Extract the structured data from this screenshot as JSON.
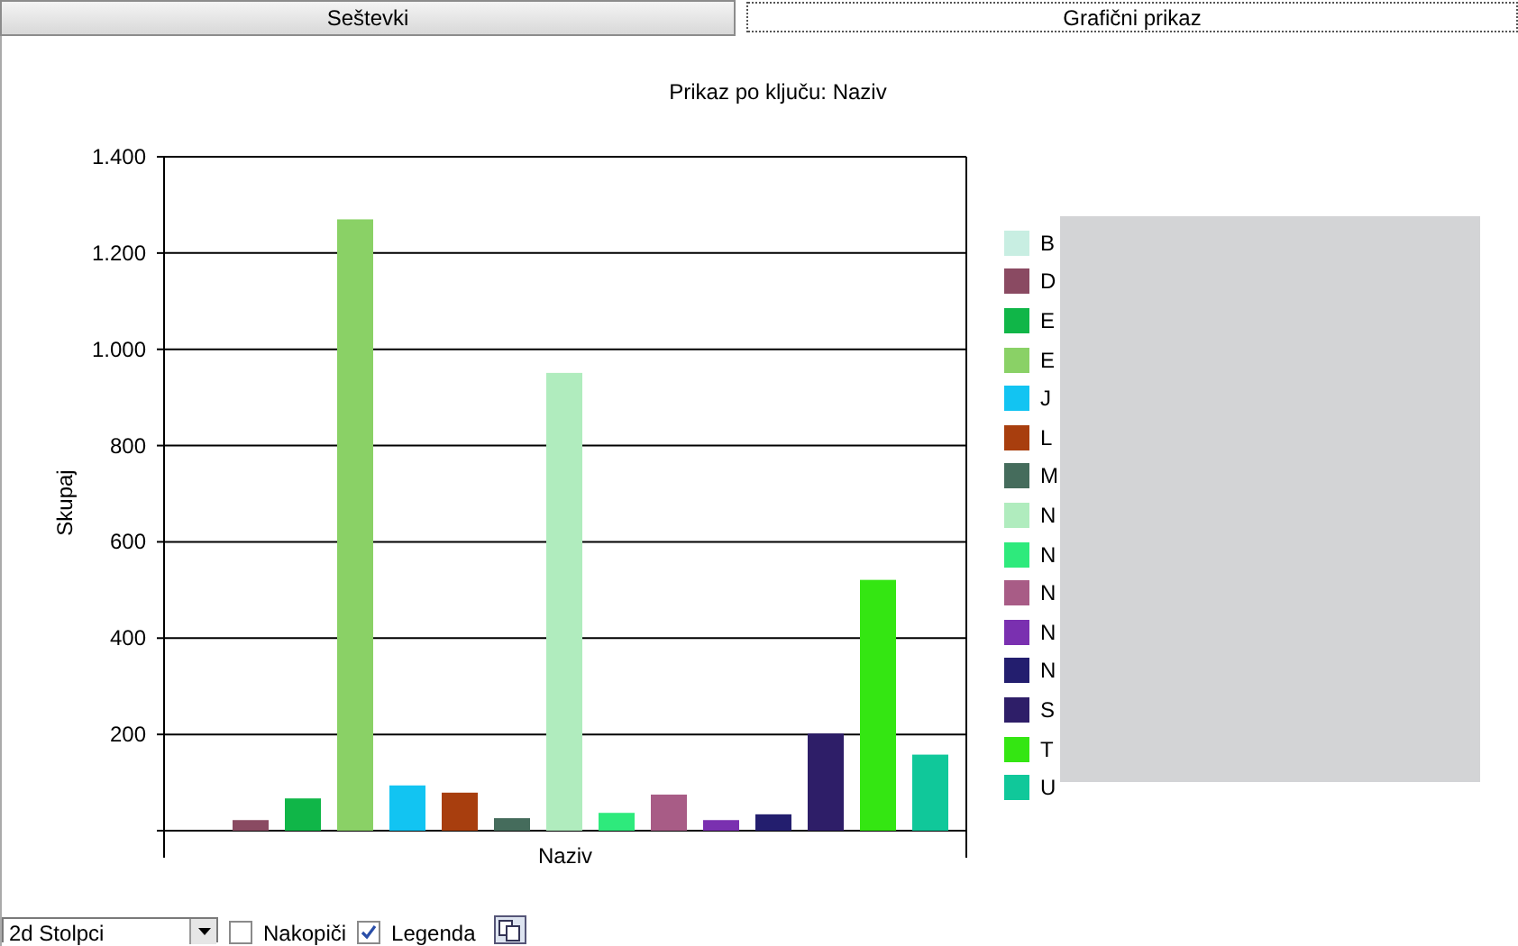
{
  "tabs": [
    {
      "label": "Seštevki",
      "selected": false
    },
    {
      "label": "Grafični prikaz",
      "selected": true
    }
  ],
  "chart": {
    "chart_data": {
      "type": "bar",
      "title": "Prikaz po ključu: Naziv",
      "ylabel": "Skupaj",
      "categories": [
        "Naziv"
      ],
      "ylim": [
        0,
        1400
      ],
      "grid": true,
      "yticks": [
        {
          "value": 200,
          "label": "200"
        },
        {
          "value": 400,
          "label": "400"
        },
        {
          "value": 600,
          "label": "600"
        },
        {
          "value": 800,
          "label": "800"
        },
        {
          "value": 1000,
          "label": "1.000"
        },
        {
          "value": 1200,
          "label": "1.200"
        },
        {
          "value": 1400,
          "label": "1.400"
        }
      ],
      "series": [
        {
          "name": "B",
          "color": "#c8eee2",
          "values": [
            0
          ]
        },
        {
          "name": "D",
          "color": "#8a4a62",
          "values": [
            22
          ]
        },
        {
          "name": "E",
          "color": "#10b648",
          "values": [
            67
          ]
        },
        {
          "name": "E",
          "color": "#8ad166",
          "values": [
            1270
          ]
        },
        {
          "name": "J",
          "color": "#12c4f2",
          "values": [
            94
          ]
        },
        {
          "name": "L",
          "color": "#a83e0e",
          "values": [
            79
          ]
        },
        {
          "name": "M",
          "color": "#456c5c",
          "values": [
            26
          ]
        },
        {
          "name": "N",
          "color": "#b0ecbe",
          "values": [
            951
          ]
        },
        {
          "name": "N",
          "color": "#2eea7c",
          "values": [
            37
          ]
        },
        {
          "name": "N",
          "color": "#a85c86",
          "values": [
            75
          ]
        },
        {
          "name": "N",
          "color": "#7a30b0",
          "values": [
            22
          ]
        },
        {
          "name": "N",
          "color": "#231e6e",
          "values": [
            34
          ]
        },
        {
          "name": "S",
          "color": "#2e1e68",
          "values": [
            202
          ]
        },
        {
          "name": "T",
          "color": "#34e612",
          "values": [
            521
          ]
        },
        {
          "name": "U",
          "color": "#10c89a",
          "values": [
            158
          ]
        }
      ]
    }
  },
  "controls": {
    "chart_type": "2d Stolpci",
    "stack": {
      "label": "Nakopiči",
      "checked": false
    },
    "legend": {
      "label": "Legenda",
      "checked": true
    }
  }
}
